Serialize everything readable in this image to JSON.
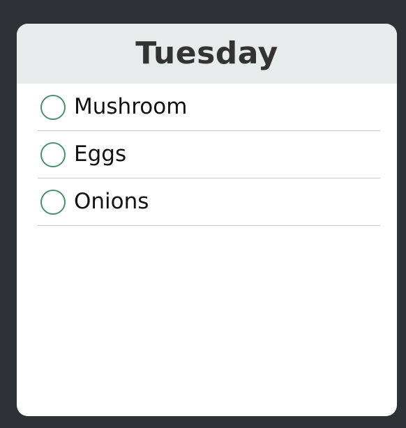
{
  "card": {
    "title": "Tuesday"
  },
  "tasks": [
    {
      "label": "Mushroom",
      "checked": false
    },
    {
      "label": "Eggs",
      "checked": false
    },
    {
      "label": "Onions",
      "checked": false
    }
  ],
  "colors": {
    "background": "#2e3136",
    "header": "#e8ebeb",
    "checkbox_border": "#4a8f6a",
    "divider": "#c8c8c8"
  }
}
